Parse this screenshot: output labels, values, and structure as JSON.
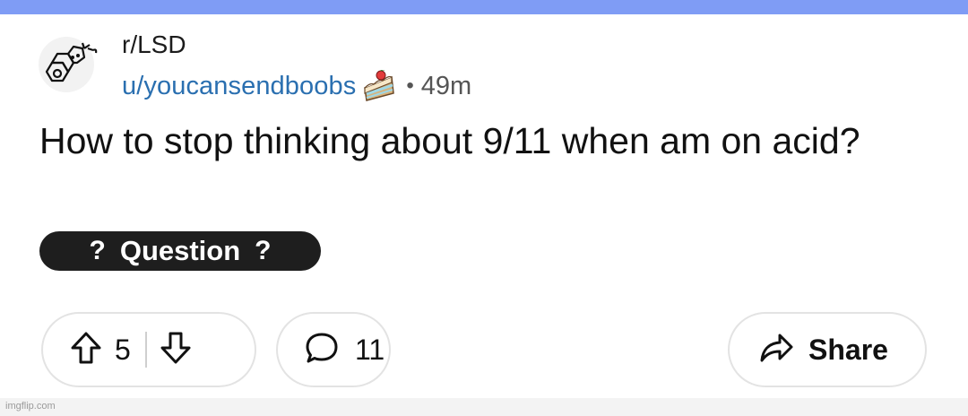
{
  "post": {
    "subreddit": "r/LSD",
    "username": "u/youcansendboobs",
    "separator": "•",
    "age": "49m",
    "title": "How to stop thinking about 9/11 when am on acid?",
    "flair": {
      "left_glyph": "?",
      "label": "Question",
      "right_glyph": "?"
    }
  },
  "actions": {
    "votes": "5",
    "comments": "11",
    "share_label": "Share"
  },
  "icons": {
    "avatar": "lsd-molecule-icon",
    "user_badge": "cake-slice-icon",
    "upvote": "arrow-up-icon",
    "downvote": "arrow-down-icon",
    "comment": "speech-bubble-icon",
    "share": "share-arrow-icon"
  },
  "colors": {
    "top_bar": "#7f9cf5",
    "username": "#2a6fb0",
    "flair_bg": "#1e1e1e",
    "pill_border": "#e3e3e3"
  },
  "watermark": "imgflip.com"
}
